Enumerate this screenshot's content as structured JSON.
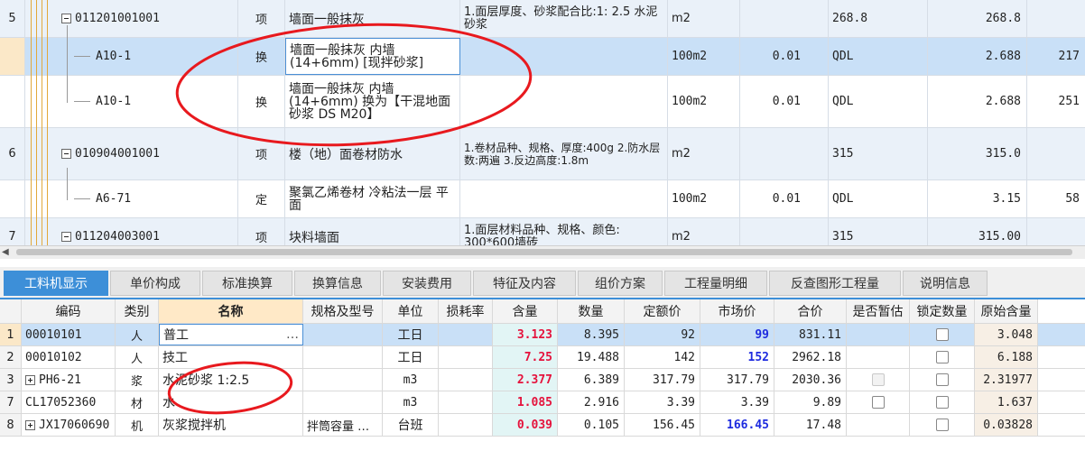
{
  "upper_grid": {
    "rows": [
      {
        "num": "5",
        "code": "011201001001",
        "type": "项",
        "name": "墙面一般抹灰",
        "feature": "1.面层厚度、砂浆配合比:1: 2.5 水泥砂浆",
        "unit": "m2",
        "qty": "",
        "expr": "268.8",
        "amount": "268.8",
        "price": ""
      },
      {
        "num": "",
        "code": "A10-1",
        "type": "换",
        "name": "墙面一般抹灰 内墙(14+6mm) [现拌砂浆]",
        "feature": "",
        "unit": "100m2",
        "qty": "0.01",
        "expr": "QDL",
        "amount": "2.688",
        "price": "217"
      },
      {
        "num": "",
        "code": "A10-1",
        "type": "换",
        "name": "墙面一般抹灰 内墙(14+6mm) 换为【干混地面砂浆 DS M20】",
        "feature": "",
        "unit": "100m2",
        "qty": "0.01",
        "expr": "QDL",
        "amount": "2.688",
        "price": "251"
      },
      {
        "num": "6",
        "code": "010904001001",
        "type": "项",
        "name": "楼（地）面卷材防水",
        "feature": "1.卷材品种、规格、厚度:400g 2.防水层数:两遍 3.反边高度:1.8m",
        "unit": "m2",
        "qty": "",
        "expr": "315",
        "amount": "315.0",
        "price": ""
      },
      {
        "num": "",
        "code": "A6-71",
        "type": "定",
        "name": "聚氯乙烯卷材 冷粘法一层 平面",
        "feature": "",
        "unit": "100m2",
        "qty": "0.01",
        "expr": "QDL",
        "amount": "3.15",
        "price": "58"
      },
      {
        "num": "7",
        "code": "011204003001",
        "type": "项",
        "name": "块料墙面",
        "feature": "1.面层材料品种、规格、颜色: 300*600墙砖",
        "unit": "m2",
        "qty": "",
        "expr": "315",
        "amount": "315.00",
        "price": ""
      }
    ]
  },
  "tabs": [
    "工料机显示",
    "单价构成",
    "标准换算",
    "换算信息",
    "安装费用",
    "特征及内容",
    "组价方案",
    "工程量明细",
    "反查图形工程量",
    "说明信息"
  ],
  "lower_grid": {
    "headers": [
      "编码",
      "类别",
      "名称",
      "规格及型号",
      "单位",
      "损耗率",
      "含量",
      "数量",
      "定额价",
      "市场价",
      "合价",
      "是否暂估",
      "锁定数量",
      "原始含量"
    ],
    "rows": [
      {
        "num": "1",
        "code": "00010101",
        "cat": "人",
        "name": "普工",
        "spec": "",
        "unit": "工日",
        "loss": "",
        "content": "3.123",
        "qty": "8.395",
        "quota": "92",
        "market": "99",
        "total": "831.11",
        "orig": "3.048"
      },
      {
        "num": "2",
        "code": "00010102",
        "cat": "人",
        "name": "技工",
        "spec": "",
        "unit": "工日",
        "loss": "",
        "content": "7.25",
        "qty": "19.488",
        "quota": "142",
        "market": "152",
        "total": "2962.18",
        "orig": "6.188"
      },
      {
        "num": "3",
        "code": "PH6-21",
        "cat": "浆",
        "name": "水泥砂浆 1:2.5",
        "spec": "",
        "unit": "m3",
        "loss": "",
        "content": "2.377",
        "qty": "6.389",
        "quota": "317.79",
        "market": "317.79",
        "total": "2030.36",
        "orig": "2.31977"
      },
      {
        "num": "7",
        "code": "CL17052360",
        "cat": "材",
        "name": "水",
        "spec": "",
        "unit": "m3",
        "loss": "",
        "content": "1.085",
        "qty": "2.916",
        "quota": "3.39",
        "market": "3.39",
        "total": "9.89",
        "orig": "1.637"
      },
      {
        "num": "8",
        "code": "JX17060690",
        "cat": "机",
        "name": "灰浆搅拌机",
        "spec": "拌筒容量 …",
        "unit": "台班",
        "loss": "",
        "content": "0.039",
        "qty": "0.105",
        "quota": "156.45",
        "market": "166.45",
        "total": "17.48",
        "orig": "0.03828"
      }
    ]
  },
  "ellipsis": "…",
  "colors": {
    "accent": "#3d8fd8",
    "selected_row": "#c9e0f7",
    "alt_row": "#eaf1f9",
    "quantity_text": "#e5123c",
    "market_price_text": "#1e2bdf",
    "annotation": "#e8191e"
  },
  "icons": [
    "tree-collapse-icon",
    "tree-expand-icon",
    "scroll-left-icon",
    "checkbox-icon",
    "ellipsis-button-icon"
  ]
}
